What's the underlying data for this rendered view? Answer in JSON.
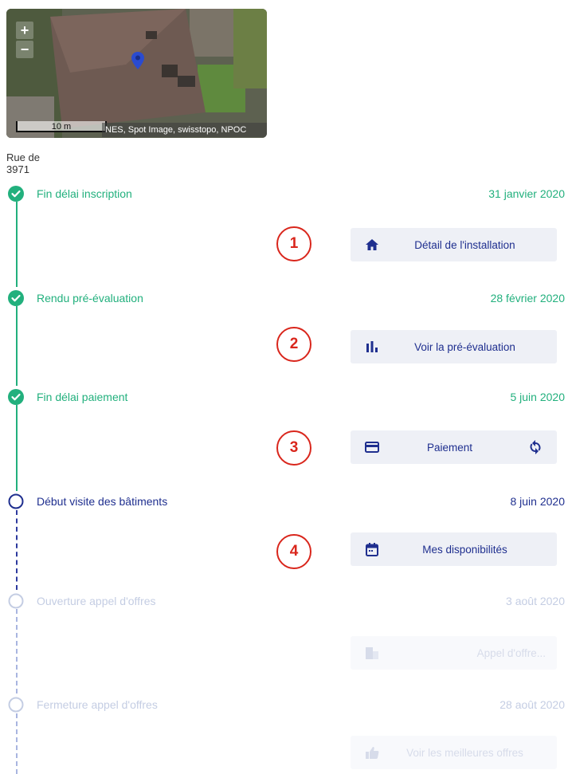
{
  "map": {
    "zoom_in": "+",
    "zoom_out": "−",
    "scale_label": "10 m",
    "attribution": "NES, Spot Image, swisstopo, NPOC"
  },
  "address": {
    "line1": "Rue de",
    "line2": "3971"
  },
  "colors": {
    "done": "#22b07d",
    "current": "#1f2f8f",
    "future": "#c4cde3",
    "badge": "#d9261c"
  },
  "timeline": [
    {
      "label": "Fin délai inscription",
      "date": "31 janvier 2020",
      "status": "done"
    },
    {
      "label": "Rendu pré-évaluation",
      "date": "28 février 2020",
      "status": "done"
    },
    {
      "label": "Fin délai paiement",
      "date": "5 juin 2020",
      "status": "done"
    },
    {
      "label": "Début visite des bâtiments",
      "date": "8 juin 2020",
      "status": "current"
    },
    {
      "label": "Ouverture appel d'offres",
      "date": "3 août 2020",
      "status": "future"
    },
    {
      "label": "Fermeture appel d'offres",
      "date": "28 août 2020",
      "status": "future"
    }
  ],
  "actions": [
    {
      "label": "Détail de l'installation",
      "icon": "home-icon",
      "badge": "1"
    },
    {
      "label": "Voir la pré-évaluation",
      "icon": "bar-chart-icon",
      "badge": "2"
    },
    {
      "label": "Paiement",
      "icon": "credit-card-icon",
      "right_icon": "refresh-icon",
      "badge": "3"
    },
    {
      "label": "Mes disponibilités",
      "icon": "calendar-icon",
      "badge": "4"
    },
    {
      "label": "Appel d'offre...",
      "icon": "building-icon"
    },
    {
      "label": "Voir les meilleures offres",
      "icon": "thumbs-up-icon"
    }
  ]
}
